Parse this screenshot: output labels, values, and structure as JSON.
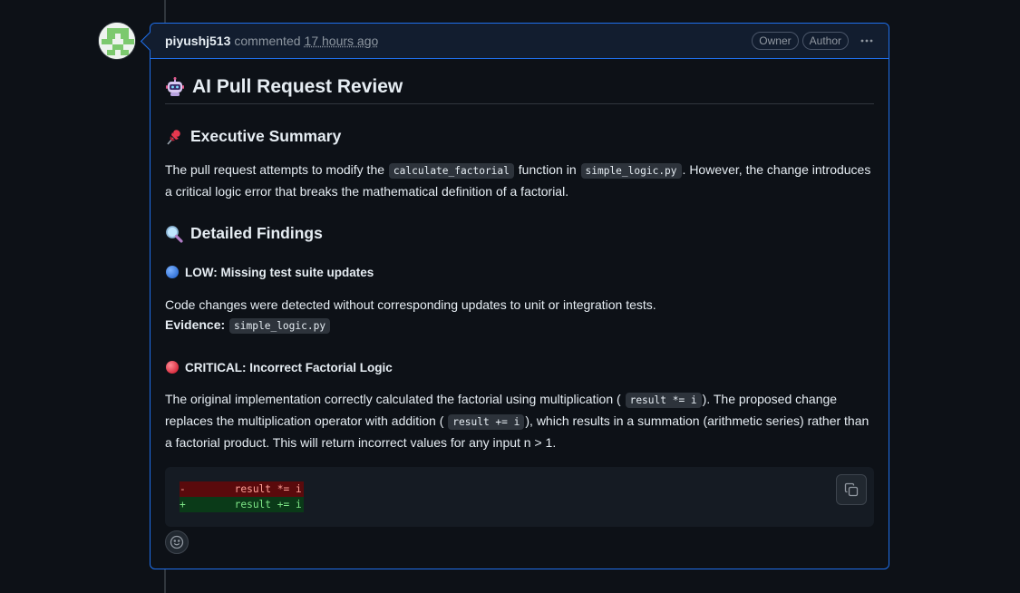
{
  "comment": {
    "author": "piyushj513",
    "action": "commented",
    "time": "17 hours ago",
    "badges": [
      "Owner",
      "Author"
    ],
    "more_icon": "kebab-horizontal-icon"
  },
  "review": {
    "title": "AI Pull Request Review",
    "title_icon": "robot-emoji-icon",
    "summary": {
      "heading": "Executive Summary",
      "icon": "pushpin-emoji-icon",
      "text_1": "The pull request attempts to modify the",
      "code_1": "calculate_factorial",
      "text_2": "function in",
      "code_2": "simple_logic.py",
      "text_3": ". However, the change introduces a critical logic error that breaks the mathematical definition of a factorial."
    },
    "findings": {
      "heading": "Detailed Findings",
      "icon": "magnifying-glass-emoji-icon",
      "items": [
        {
          "title": "LOW: Missing test suite updates",
          "icon": "blue-circle-emoji-icon",
          "description": "Code changes were detected without corresponding updates to unit or integration tests.",
          "evidence_label": "Evidence:",
          "evidence_code": "simple_logic.py"
        },
        {
          "title": "CRITICAL: Incorrect Factorial Logic",
          "icon": "red-circle-emoji-icon",
          "text_1": "The original implementation correctly calculated the factorial using multiplication (",
          "code_1": "result *= i",
          "text_2": "). The proposed change replaces the multiplication operator with addition (",
          "code_2": "result += i",
          "text_3": "), which results in a summation (arithmetic series) rather than a factorial product. This will return incorrect values for any input n > 1.",
          "diff": {
            "removed": "-        result *= i",
            "added": "+        result += i"
          }
        }
      ]
    }
  },
  "actions": {
    "copy_icon": "copy-icon",
    "reaction_icon": "smiley-icon"
  }
}
